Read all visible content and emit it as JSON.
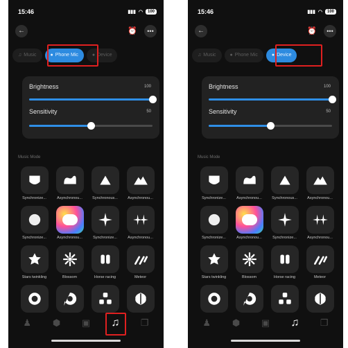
{
  "screens": [
    {
      "status": {
        "time": "15:46",
        "battery": "100"
      },
      "tabs": [
        {
          "label": "Music",
          "active": false
        },
        {
          "label": "Phone Mic",
          "active": true
        },
        {
          "label": "Device",
          "active": false
        }
      ],
      "sliders": [
        {
          "label": "Brightness",
          "value": "100",
          "level": 1.0
        },
        {
          "label": "Sensitivity",
          "value": "50",
          "level": 0.5
        }
      ],
      "section_title": "Music Mode",
      "modes": [
        {
          "icon": "cup-icon",
          "label": "Synchronize..."
        },
        {
          "icon": "wave-icon",
          "label": "Asynchronou..."
        },
        {
          "icon": "triangle-icon",
          "label": "Synchronous..."
        },
        {
          "icon": "mountain-icon",
          "label": "Asynchronou..."
        },
        {
          "icon": "sphere-icon",
          "label": "Synchronize..."
        },
        {
          "icon": "colorful-icon",
          "label": "Asynchronou..."
        },
        {
          "icon": "sparkle-icon",
          "label": "Synchronize..."
        },
        {
          "icon": "double-sparkle-icon",
          "label": "Asynchronou..."
        },
        {
          "icon": "star-flower-icon",
          "label": "Stars twinkling"
        },
        {
          "icon": "blossom-icon",
          "label": "Blossom"
        },
        {
          "icon": "horse-racing-icon",
          "label": "Horse racing"
        },
        {
          "icon": "meteor-icon",
          "label": "Meteor"
        },
        {
          "icon": "ring-icon",
          "label": ""
        },
        {
          "icon": "drop-ring-icon",
          "label": ""
        },
        {
          "icon": "cluster-icon",
          "label": ""
        },
        {
          "icon": "leaf-ball-icon",
          "label": ""
        }
      ],
      "nav": [
        {
          "icon": "scene-icon",
          "active": false
        },
        {
          "icon": "shield-icon",
          "active": false
        },
        {
          "icon": "video-icon",
          "active": false
        },
        {
          "icon": "music-note-icon",
          "active": true
        },
        {
          "icon": "copy-icon",
          "active": false
        }
      ]
    },
    {
      "status": {
        "time": "15:46",
        "battery": "100"
      },
      "tabs": [
        {
          "label": "Music",
          "active": false
        },
        {
          "label": "Phone Mic",
          "active": false
        },
        {
          "label": "Device",
          "active": true
        }
      ],
      "sliders": [
        {
          "label": "Brightness",
          "value": "100",
          "level": 1.0
        },
        {
          "label": "Sensitivity",
          "value": "50",
          "level": 0.5
        }
      ],
      "section_title": "Music Mode",
      "modes": [
        {
          "icon": "cup-icon",
          "label": "Synchronize..."
        },
        {
          "icon": "wave-icon",
          "label": "Asynchronou..."
        },
        {
          "icon": "triangle-icon",
          "label": "Synchronous..."
        },
        {
          "icon": "mountain-icon",
          "label": "Asynchronou..."
        },
        {
          "icon": "sphere-icon",
          "label": "Synchronize..."
        },
        {
          "icon": "colorful-icon",
          "label": "Asynchronou..."
        },
        {
          "icon": "sparkle-icon",
          "label": "Synchronize..."
        },
        {
          "icon": "double-sparkle-icon",
          "label": "Asynchronou..."
        },
        {
          "icon": "star-flower-icon",
          "label": "Stars twinkling"
        },
        {
          "icon": "blossom-icon",
          "label": "Blossom"
        },
        {
          "icon": "horse-racing-icon",
          "label": "Horse racing"
        },
        {
          "icon": "meteor-icon",
          "label": "Meteor"
        },
        {
          "icon": "ring-icon",
          "label": ""
        },
        {
          "icon": "drop-ring-icon",
          "label": ""
        },
        {
          "icon": "cluster-icon",
          "label": ""
        },
        {
          "icon": "leaf-ball-icon",
          "label": ""
        }
      ],
      "nav": [
        {
          "icon": "scene-icon",
          "active": false
        },
        {
          "icon": "shield-icon",
          "active": false
        },
        {
          "icon": "video-icon",
          "active": false
        },
        {
          "icon": "music-note-icon",
          "active": true
        },
        {
          "icon": "copy-icon",
          "active": false
        }
      ]
    }
  ],
  "colors": {
    "accent": "#2d8be0",
    "highlight": "#e02020",
    "background": "#101010"
  }
}
